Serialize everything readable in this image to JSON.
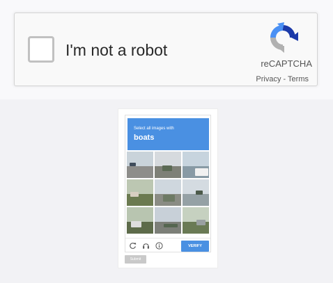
{
  "anchor": {
    "checkbox_label": "I'm not a robot",
    "brand": "reCAPTCHA",
    "privacy": "Privacy",
    "separator": "-",
    "terms": "Terms"
  },
  "challenge": {
    "instruction": "Select all images with",
    "target": "boats",
    "tiles": [
      {
        "sky": "#c9d3da",
        "ground": "#8d8d8a",
        "obj": "#3f4d5c"
      },
      {
        "sky": "#d6dade",
        "ground": "#7e8077",
        "obj": "#5b6a54"
      },
      {
        "sky": "#c7d4de",
        "ground": "#889aa5",
        "obj": "#f1f1f1"
      },
      {
        "sky": "#bcc7b2",
        "ground": "#6b7a50",
        "obj": "#d8cfc2"
      },
      {
        "sky": "#cfd7de",
        "ground": "#8a8c84",
        "obj": "#6d7a64"
      },
      {
        "sky": "#d4dbe1",
        "ground": "#95a1a5",
        "obj": "#4c5a4a"
      },
      {
        "sky": "#b8c5b0",
        "ground": "#5d6b4a",
        "obj": "#dedede"
      },
      {
        "sky": "#c8d0d8",
        "ground": "#7c7f78",
        "obj": "#556650"
      },
      {
        "sky": "#c6d1c0",
        "ground": "#6a7a55",
        "obj": "#9aa0a2"
      }
    ],
    "verify_label": "VERIFY",
    "submit_label": "Submit"
  },
  "colors": {
    "accent": "#4a90e2",
    "logo_blue": "#1c3aa9",
    "logo_light_blue": "#4a90f4",
    "logo_gray": "#b1b1b1"
  }
}
